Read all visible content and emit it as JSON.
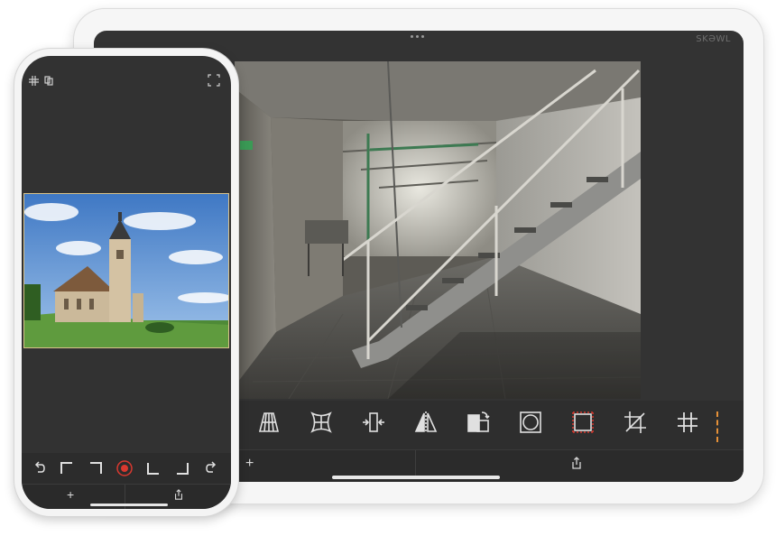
{
  "tablet": {
    "brand": "SKƏWL",
    "photo": "abandoned-factory-staircase",
    "toolbar": [
      {
        "name": "vertical-perspective-icon"
      },
      {
        "name": "free-perspective-icon"
      },
      {
        "name": "horizontal-stretch-icon"
      },
      {
        "name": "mirror-flip-icon"
      },
      {
        "name": "rotate-aspect-icon"
      },
      {
        "name": "circle-crop-icon"
      },
      {
        "name": "square-crop-icon"
      },
      {
        "name": "crop-icon"
      },
      {
        "name": "grid-icon"
      }
    ],
    "bottom": {
      "add_label": "+"
    }
  },
  "phone": {
    "photo": "church-landscape",
    "toolbar": [
      {
        "name": "undo-icon"
      },
      {
        "name": "corner-top-left-icon"
      },
      {
        "name": "corner-top-right-icon"
      },
      {
        "name": "center-point-icon"
      },
      {
        "name": "corner-bottom-left-icon"
      },
      {
        "name": "corner-bottom-right-icon"
      },
      {
        "name": "redo-icon"
      }
    ],
    "bottom": {
      "add_label": "+"
    }
  },
  "colors": {
    "accent": "#e69138",
    "record": "#d9382f",
    "frame": "#d8c28a"
  }
}
